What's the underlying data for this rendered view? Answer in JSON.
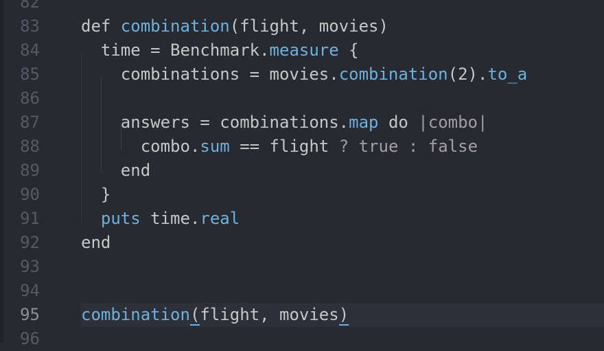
{
  "editor": {
    "current_line": "95",
    "colors": {
      "background": "#272a31",
      "function": "#6fb0dc",
      "text": "#c5c8c6",
      "line_number": "#555a63"
    },
    "lines": [
      {
        "number": "82",
        "tokens": []
      },
      {
        "number": "83",
        "tokens": [
          [
            "def ",
            "txt"
          ],
          [
            "combination",
            "fn"
          ],
          [
            "(flight, movies)",
            "txt"
          ]
        ]
      },
      {
        "number": "84",
        "tokens": [
          [
            "  time = Benchmark.",
            "txt"
          ],
          [
            "measure",
            "fn"
          ],
          [
            " {",
            "txt"
          ]
        ]
      },
      {
        "number": "85",
        "tokens": [
          [
            "    combinations = movies.",
            "txt"
          ],
          [
            "combination",
            "fn"
          ],
          [
            "(2).",
            "txt"
          ],
          [
            "to_a",
            "fn"
          ]
        ]
      },
      {
        "number": "86",
        "tokens": []
      },
      {
        "number": "87",
        "tokens": [
          [
            "    answers = combinations.",
            "txt"
          ],
          [
            "map",
            "fn"
          ],
          [
            " do ",
            "txt"
          ],
          [
            "|combo|",
            "dim"
          ]
        ]
      },
      {
        "number": "88",
        "tokens": [
          [
            "      combo.",
            "txt"
          ],
          [
            "sum",
            "fn"
          ],
          [
            " == flight ",
            "txt"
          ],
          [
            "?",
            "dim"
          ],
          [
            " ",
            "txt"
          ],
          [
            "true",
            "dim"
          ],
          [
            " ",
            "txt"
          ],
          [
            ":",
            "dim"
          ],
          [
            " ",
            "txt"
          ],
          [
            "false",
            "dim"
          ]
        ]
      },
      {
        "number": "89",
        "tokens": [
          [
            "    end",
            "txt"
          ]
        ]
      },
      {
        "number": "90",
        "tokens": [
          [
            "  }",
            "txt"
          ]
        ]
      },
      {
        "number": "91",
        "tokens": [
          [
            "  puts ",
            "fn"
          ],
          [
            "time.",
            "txt"
          ],
          [
            "real",
            "fn"
          ]
        ]
      },
      {
        "number": "92",
        "tokens": [
          [
            "end",
            "txt"
          ]
        ]
      },
      {
        "number": "93",
        "tokens": []
      },
      {
        "number": "94",
        "tokens": []
      },
      {
        "number": "95",
        "tokens": [
          [
            "combination",
            "fn"
          ],
          [
            "(",
            "bracket"
          ],
          [
            "flight, movies",
            "txt"
          ],
          [
            ")",
            "bracket"
          ]
        ]
      },
      {
        "number": "96",
        "tokens": []
      }
    ]
  }
}
